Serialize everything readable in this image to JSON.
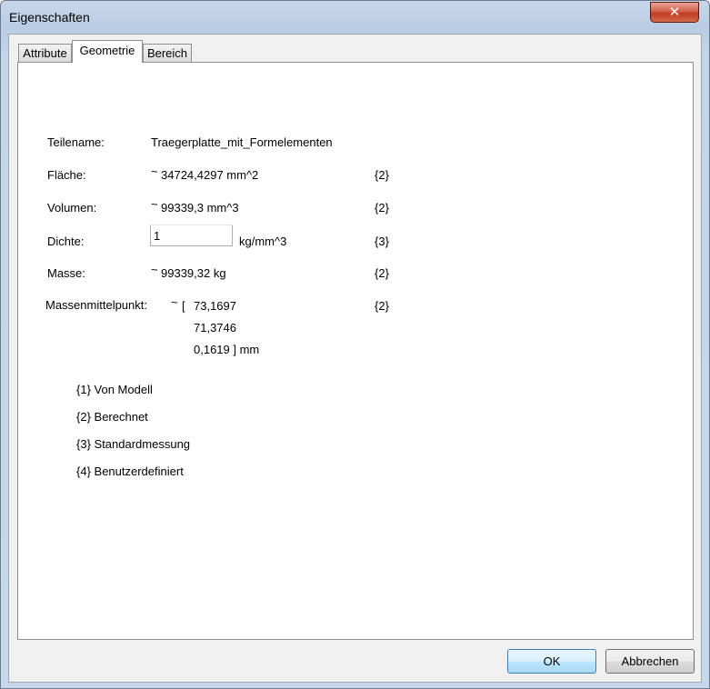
{
  "window": {
    "title": "Eigenschaften",
    "close_label": "✕"
  },
  "tabs": [
    {
      "label": "Attribute",
      "active": false
    },
    {
      "label": "Geometrie",
      "active": true
    },
    {
      "label": "Bereich",
      "active": false
    }
  ],
  "properties": {
    "teilename": {
      "label": "Teilename:",
      "value": "Traegerplatte_mit_Formelementen"
    },
    "flaeche": {
      "label": "Fläche:",
      "approx": "~",
      "value": "34724,4297 mm^2",
      "source": "{2}"
    },
    "volumen": {
      "label": "Volumen:",
      "approx": "~",
      "value": "99339,3 mm^3",
      "source": "{2}"
    },
    "dichte": {
      "label": "Dichte:",
      "input_value": "1",
      "unit": "kg/mm^3",
      "source": "{3}"
    },
    "masse": {
      "label": "Masse:",
      "approx": "~",
      "value": "99339,32 kg",
      "source": "{2}"
    },
    "massenmittelpunkt": {
      "label": "Massenmittelpunkt:",
      "approx": "~",
      "bracket_open": "[",
      "x": "73,1697",
      "y": "71,3746",
      "z": "0,1619 ] mm",
      "source": "{2}"
    }
  },
  "legend": [
    "{1} Von Modell",
    "{2} Berechnet",
    "{3} Standardmessung",
    "{4} Benutzerdefiniert"
  ],
  "buttons": {
    "ok": "OK",
    "cancel": "Abbrechen"
  }
}
